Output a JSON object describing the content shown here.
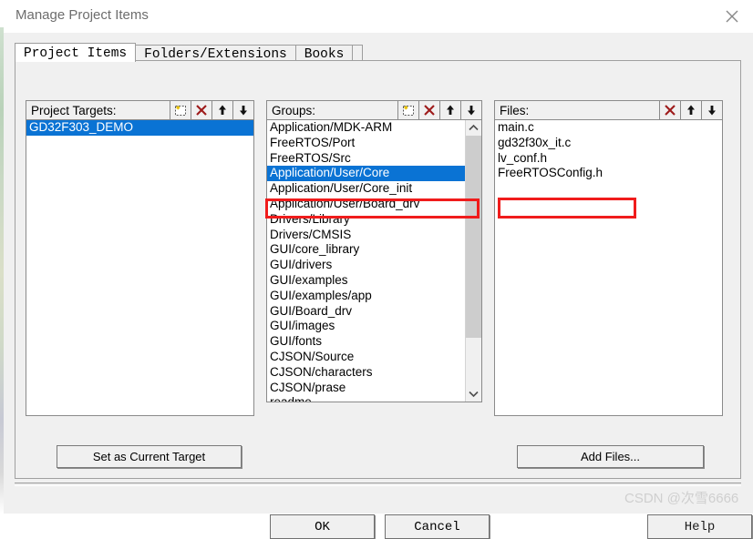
{
  "window": {
    "title": "Manage Project Items",
    "close_icon": "close-icon"
  },
  "tabs": [
    {
      "label": "Project Items",
      "active": true
    },
    {
      "label": "Folders/Extensions",
      "active": false
    },
    {
      "label": "Books",
      "active": false
    }
  ],
  "panels": {
    "targets": {
      "title": "Project Targets:",
      "tools": [
        "new-item-icon",
        "delete-icon",
        "move-up-icon",
        "move-down-icon"
      ],
      "items": [
        "GD32F303_DEMO"
      ],
      "selected_index": 0
    },
    "groups": {
      "title": "Groups:",
      "tools": [
        "new-item-icon",
        "delete-icon",
        "move-up-icon",
        "move-down-icon"
      ],
      "items": [
        "Application/MDK-ARM",
        "FreeRTOS/Port",
        "FreeRTOS/Src",
        "Application/User/Core",
        "Application/User/Core_init",
        "Application/User/Board_drv",
        "Drivers/Library",
        "Drivers/CMSIS",
        "GUI/core_library",
        "GUI/drivers",
        "GUI/examples",
        "GUI/examples/app",
        "GUI/Board_drv",
        "GUI/images",
        "GUI/fonts",
        "CJSON/Source",
        "CJSON/characters",
        "CJSON/prase",
        "readme"
      ],
      "selected_index": 3,
      "scrollbar": {
        "up_icon": "chevron-up-icon",
        "down_icon": "chevron-down-icon"
      }
    },
    "files": {
      "title": "Files:",
      "tools": [
        "delete-icon",
        "move-up-icon",
        "move-down-icon"
      ],
      "items": [
        "main.c",
        "gd32f30x_it.c",
        "lv_conf.h",
        "FreeRTOSConfig.h"
      ],
      "selected_index": -1
    }
  },
  "buttons": {
    "set_as_current_target": "Set as Current Target",
    "add_files": "Add Files...",
    "ok": "OK",
    "cancel": "Cancel",
    "help": "Help"
  },
  "annotations": {
    "color": "#f01c1c",
    "group_target": "Application/User/Core",
    "file_target": "FreeRTOSConfig.h"
  },
  "watermark": {
    "text": "CSDN @次雪6666"
  },
  "colors": {
    "selection": "#0a73d4",
    "dialog_bg": "#f0f0f0",
    "titlebar_bg": "#ffffff",
    "annotation_red": "#f01c1c"
  }
}
